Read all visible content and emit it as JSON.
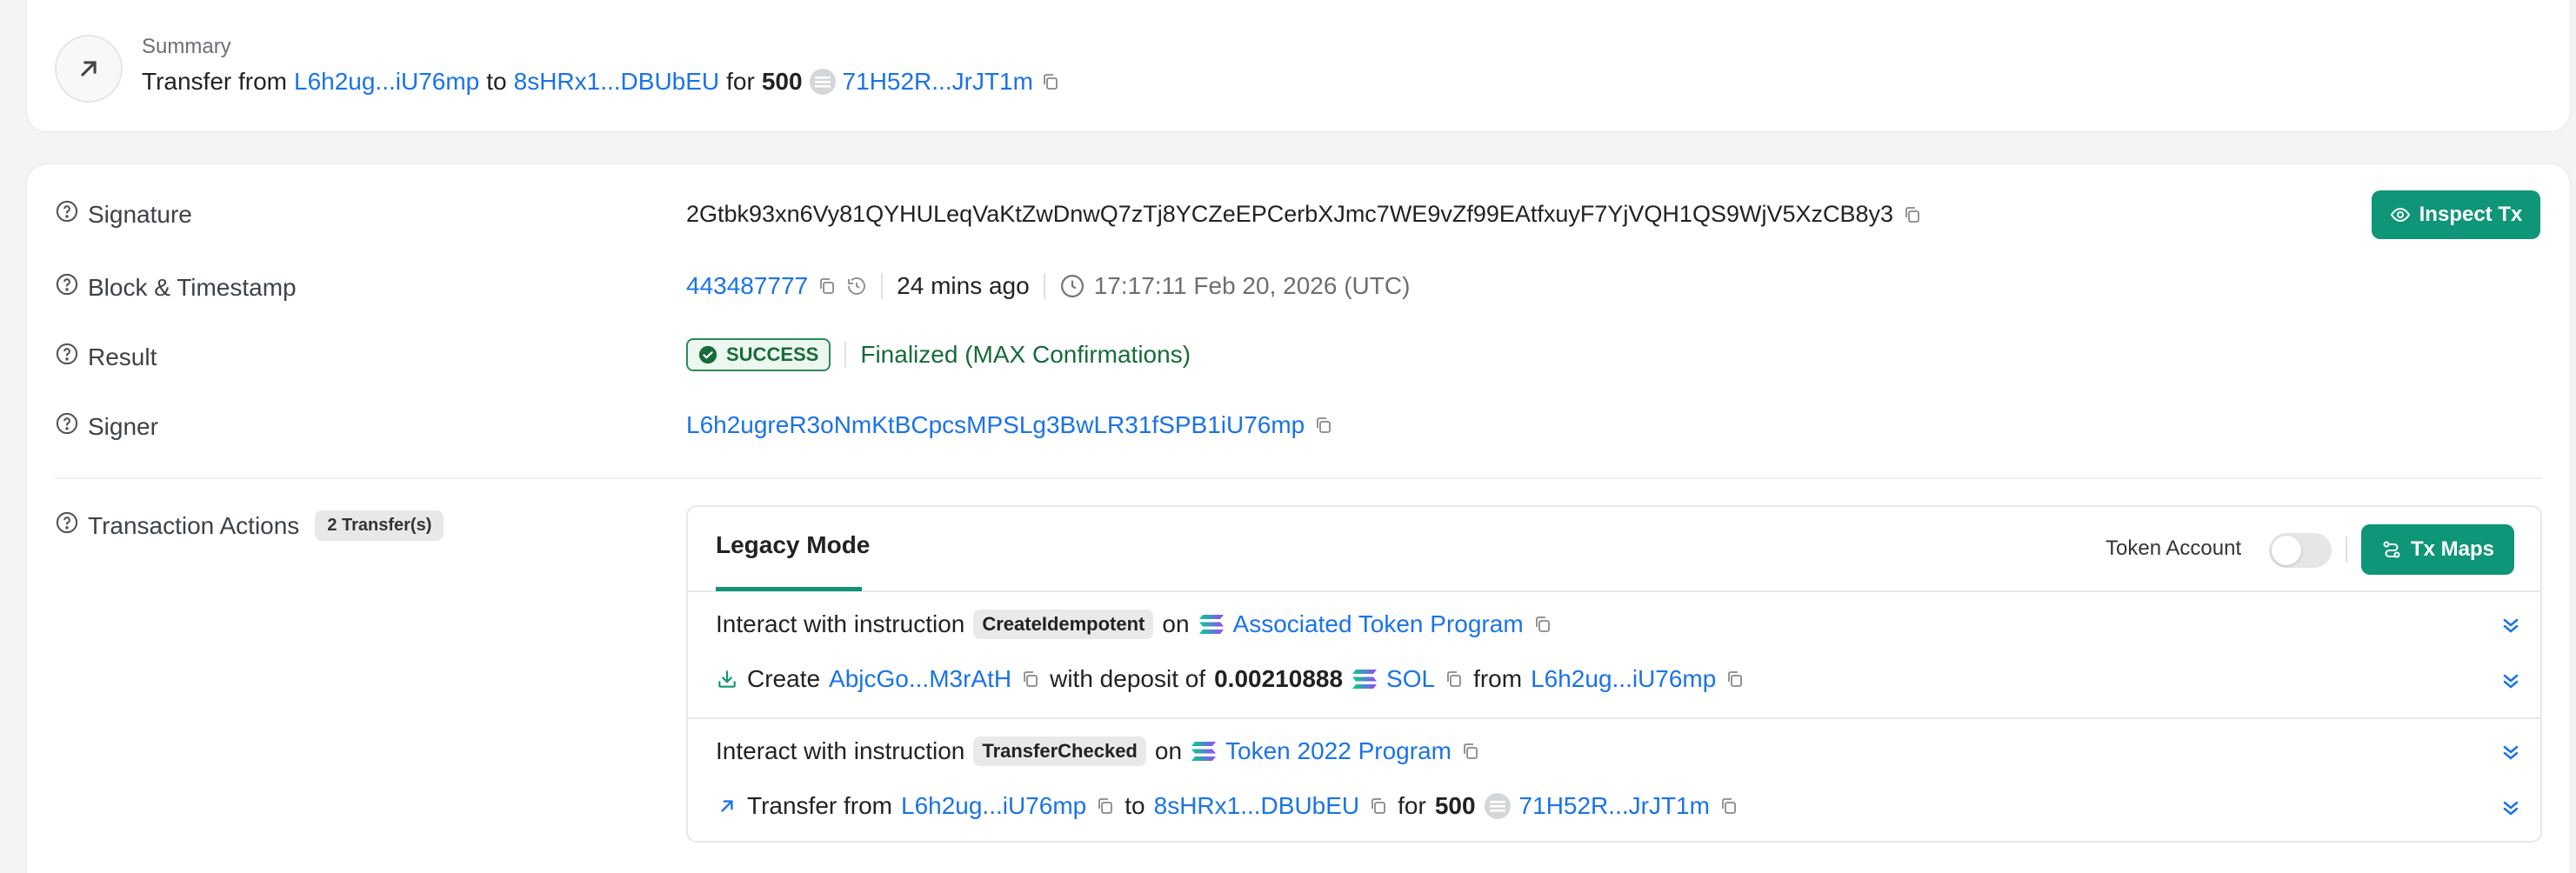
{
  "summary": {
    "label": "Summary",
    "prefix": "Transfer from",
    "from": "L6h2ug...iU76mp",
    "to_word": "to",
    "to": "8sHRx1...DBUbEU",
    "for_word": "for",
    "amount": "500",
    "token": "71H52R...JrJT1m"
  },
  "signature": {
    "label": "Signature",
    "value": "2Gtbk93xn6Vy81QYHULeqVaKtZwDnwQ7zTj8YCZeEPCerbXJmc7WE9vZf99EAtfxuyF7YjVQH1QS9WjV5XzCB8y3",
    "inspect_label": "Inspect Tx"
  },
  "block": {
    "label": "Block & Timestamp",
    "number": "443487777",
    "age": "24 mins ago",
    "timestamp": "17:17:11 Feb 20, 2026 (UTC)"
  },
  "result": {
    "label": "Result",
    "status": "SUCCESS",
    "finality": "Finalized (MAX Confirmations)"
  },
  "signer": {
    "label": "Signer",
    "value": "L6h2ugreR3oNmKtBCpcsMPSLg3BwLR31fSPB1iU76mp"
  },
  "actions": {
    "label": "Transaction Actions",
    "count_badge": "2 Transfer(s)",
    "tab": "Legacy Mode",
    "token_account_label": "Token Account",
    "txmaps_label": "Tx Maps",
    "groups": [
      {
        "prefix": "Interact with instruction",
        "instruction": "CreateIdempotent",
        "on_word": "on",
        "program": "Associated Token Program",
        "detail": {
          "verb": "Create",
          "account": "AbjcGo...M3rAtH",
          "deposit_text": "with deposit of",
          "deposit_amount": "0.00210888",
          "deposit_token": "SOL",
          "from_word": "from",
          "from": "L6h2ug...iU76mp"
        }
      },
      {
        "prefix": "Interact with instruction",
        "instruction": "TransferChecked",
        "on_word": "on",
        "program": "Token 2022 Program",
        "detail": {
          "verb": "Transfer from",
          "from": "L6h2ug...iU76mp",
          "to_word": "to",
          "to": "8sHRx1...DBUbEU",
          "for_word": "for",
          "amount": "500",
          "token": "71H52R...JrJT1m"
        }
      }
    ]
  },
  "colors": {
    "accent": "#0f9577",
    "link": "#1a73e8",
    "success": "#176b3a"
  }
}
